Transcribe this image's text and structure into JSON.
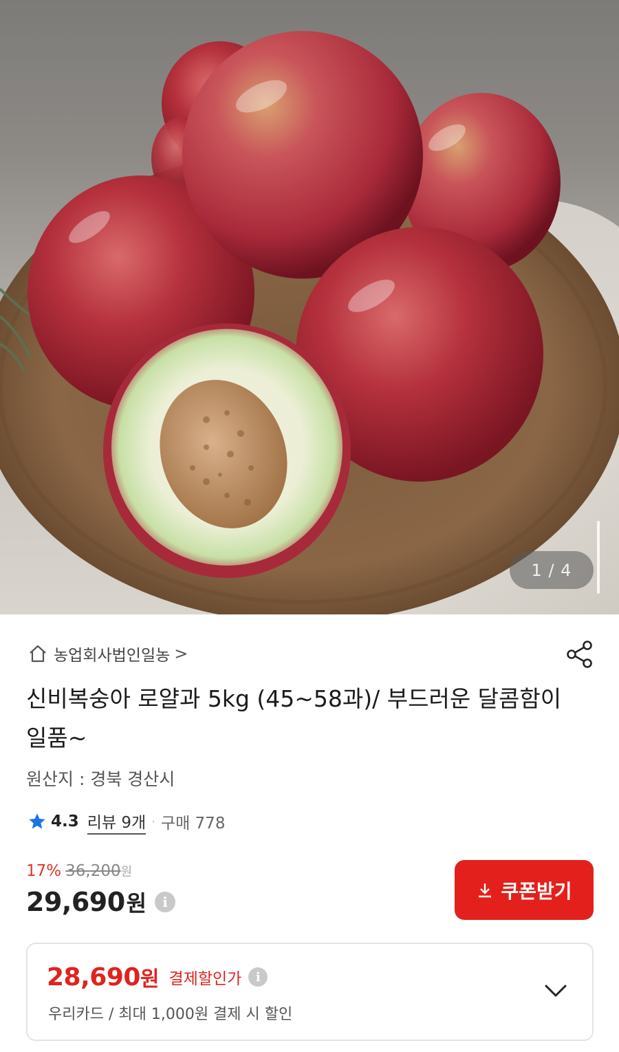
{
  "gallery": {
    "current": "1",
    "separator": "/",
    "total": "4",
    "counter_label": "1 / 4"
  },
  "store": {
    "name": "농업회사법인일농",
    "chevron": ">"
  },
  "product": {
    "title": "신비복숭아 로얄과 5kg (45~58과)/ 부드러운 달콤함이 일품~",
    "origin": "원산지 : 경북 경산시"
  },
  "rating": {
    "score": "4.3",
    "review_label": "리뷰 9개",
    "separator": "·",
    "purchase_label": "구매 778"
  },
  "price": {
    "discount_rate": "17%",
    "original": "36,200",
    "original_unit": "원",
    "sale": "29,690",
    "sale_unit": "원",
    "info_glyph": "i"
  },
  "coupon": {
    "label": "쿠폰받기"
  },
  "payment_discount": {
    "price": "28,690",
    "unit": "원",
    "tag": "결제할인가",
    "info_glyph": "i",
    "description": "우리카드 / 최대 1,000원 결제 시 할인"
  },
  "icons": {
    "store": "home-icon",
    "share": "share-icon",
    "star": "star-icon",
    "coupon": "download-arrow-icon",
    "expand": "chevron-down-icon"
  },
  "colors": {
    "accent_red": "#e4201c",
    "discount_red": "#e0352b",
    "star_blue": "#1a73e8"
  }
}
